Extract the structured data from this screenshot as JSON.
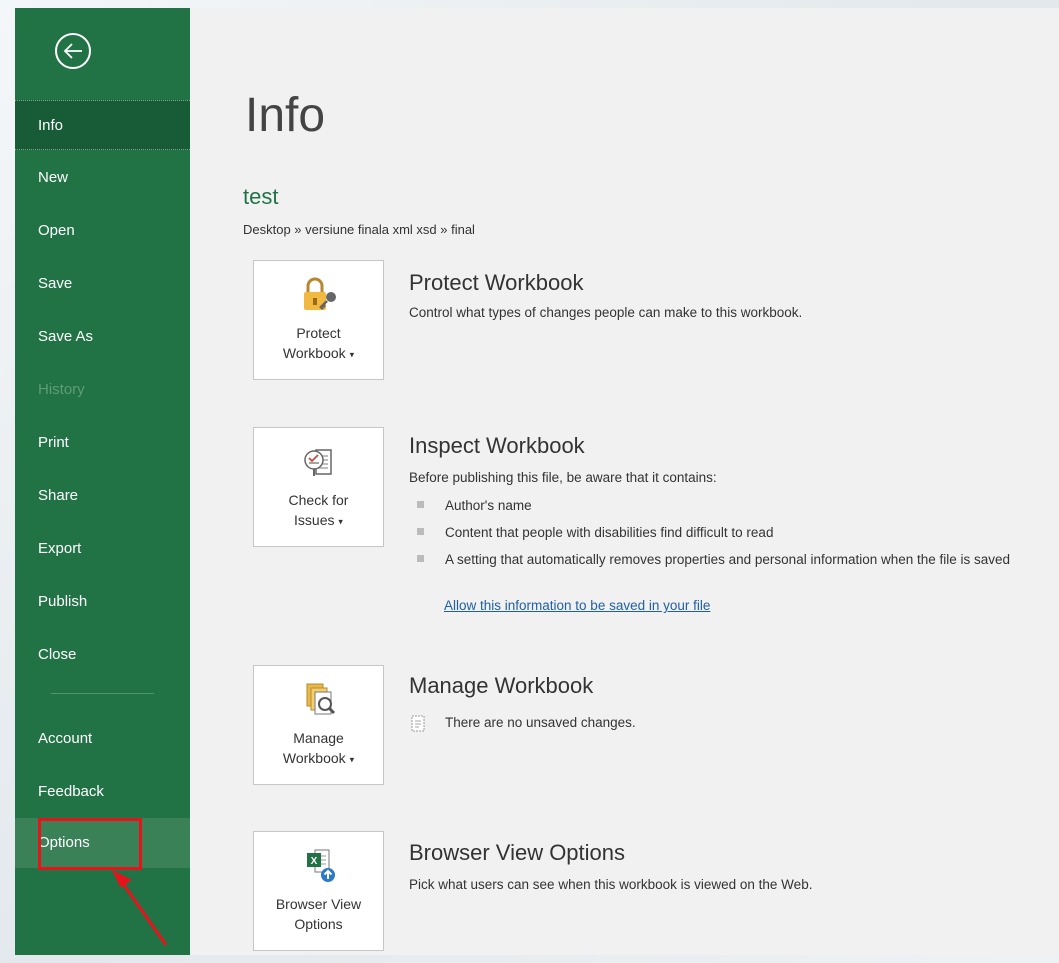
{
  "nav": {
    "items": [
      {
        "label": "Info"
      },
      {
        "label": "New"
      },
      {
        "label": "Open"
      },
      {
        "label": "Save"
      },
      {
        "label": "Save As"
      },
      {
        "label": "History"
      },
      {
        "label": "Print"
      },
      {
        "label": "Share"
      },
      {
        "label": "Export"
      },
      {
        "label": "Publish"
      },
      {
        "label": "Close"
      },
      {
        "label": "Account"
      },
      {
        "label": "Feedback"
      },
      {
        "label": "Options"
      }
    ]
  },
  "main": {
    "page_title": "Info",
    "doc_title": "test",
    "doc_path": "Desktop » versiune finala xml xsd » final",
    "protect": {
      "tile_line1": "Protect",
      "tile_line2": "Workbook",
      "title": "Protect Workbook",
      "desc": "Control what types of changes people can make to this workbook."
    },
    "inspect": {
      "tile_line1": "Check for",
      "tile_line2": "Issues",
      "title": "Inspect Workbook",
      "desc": "Before publishing this file, be aware that it contains:",
      "bullets": [
        "Author's name",
        "Content that people with disabilities find difficult to read",
        "A setting that automatically removes properties and personal information when the file is saved"
      ],
      "link": "Allow this information to be saved in your file"
    },
    "manage": {
      "tile_line1": "Manage",
      "tile_line2": "Workbook",
      "title": "Manage Workbook",
      "desc": "There are no unsaved changes."
    },
    "browser": {
      "tile_line1": "Browser View",
      "tile_line2": "Options",
      "title": "Browser View Options",
      "desc": "Pick what users can see when this workbook is viewed on the Web."
    }
  },
  "colors": {
    "sidebar": "#217346",
    "sidebar_active": "#185c37",
    "annotation": "#e8121b",
    "link": "#1f5fa8"
  }
}
